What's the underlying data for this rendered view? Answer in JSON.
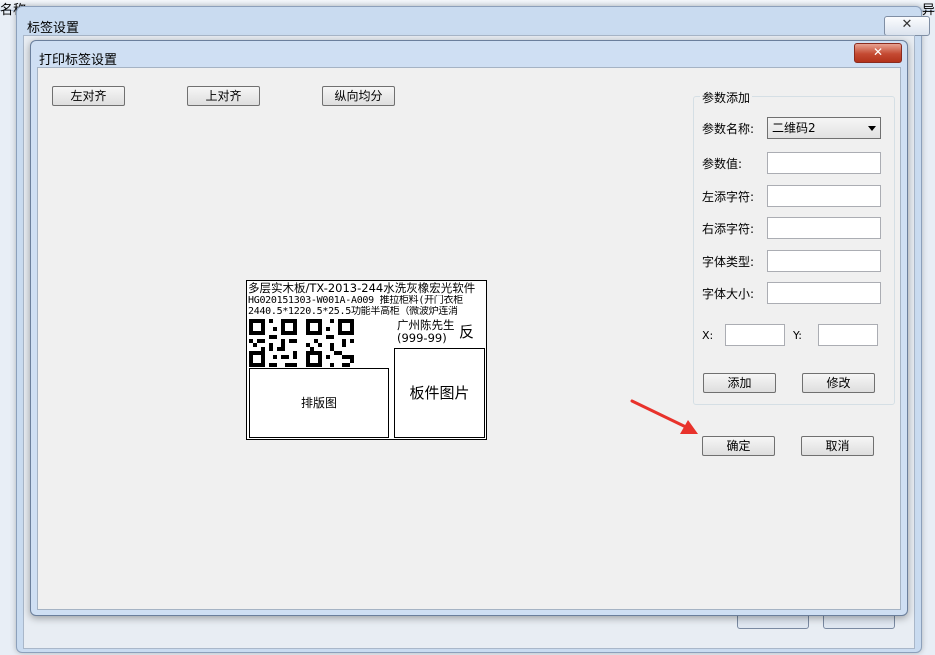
{
  "background": {
    "left_text": "名称",
    "right_text": "异"
  },
  "outer_window": {
    "title": "标签设置",
    "close_symbol": "✕"
  },
  "dialog": {
    "title": "打印标签设置",
    "close_symbol": "✕",
    "toolbar": {
      "left_align": "左对齐",
      "top_align": "上对齐",
      "vertical_distribute": "纵向均分"
    },
    "params": {
      "legend": "参数添加",
      "name_label": "参数名称:",
      "name_value": "二维码2",
      "value_label": "参数值:",
      "value_value": "",
      "left_char_label": "左添字符:",
      "left_char_value": "",
      "right_char_label": "右添字符:",
      "right_char_value": "",
      "font_type_label": "字体类型:",
      "font_type_value": "",
      "font_size_label": "字体大小:",
      "font_size_value": "",
      "x_label": "X:",
      "x_value": "",
      "y_label": "Y:",
      "y_value": "",
      "add_button": "添加",
      "modify_button": "修改"
    },
    "ok_button": "确定",
    "cancel_button": "取消",
    "label_preview": {
      "line1": "多层实木板/TX-2013-244水洗灰橡宏光软件",
      "line2": "HG020151303-W001A-A009 推拉柜料(开门衣柜",
      "line3": "2440.5*1220.5*25.5功能半高柜（微波炉连消",
      "customer": "广州陈先生",
      "code": "(999-99)",
      "side": "反",
      "layout_box": "排版图",
      "panel_box": "板件图片"
    }
  }
}
